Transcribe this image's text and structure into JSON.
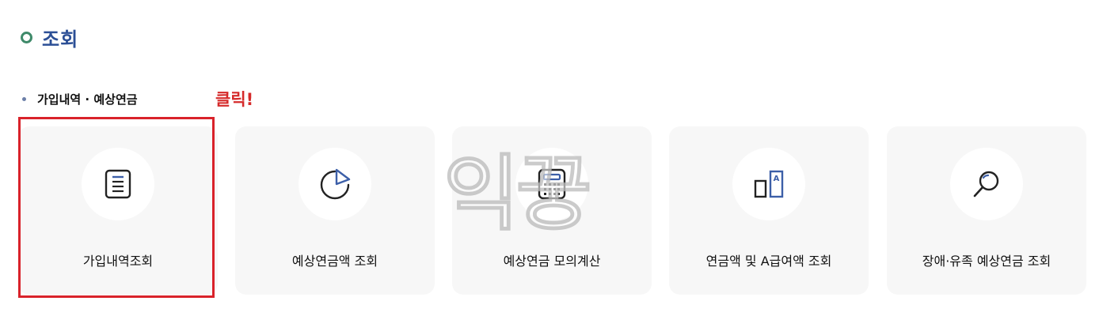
{
  "section": {
    "title": "조회"
  },
  "subsection": {
    "title": "가입내역 · 예상연금"
  },
  "annotation": {
    "click_note": "클릭!"
  },
  "watermark": {
    "text": "익꿍"
  },
  "cards": [
    {
      "label": "가입내역조회",
      "icon": "document-icon"
    },
    {
      "label": "예상연금액 조회",
      "icon": "pie-chart-icon"
    },
    {
      "label": "예상연금 모의계산",
      "icon": "calculator-icon"
    },
    {
      "label": "연금액 및 A급여액 조회",
      "icon": "compare-a-icon"
    },
    {
      "label": "장애·유족 예상연금 조회",
      "icon": "search-icon"
    }
  ],
  "colors": {
    "title": "#2c4f96",
    "accent_ring": "#3f8a6a",
    "highlight": "#d9222a",
    "icon_blue": "#3c5fa8"
  }
}
